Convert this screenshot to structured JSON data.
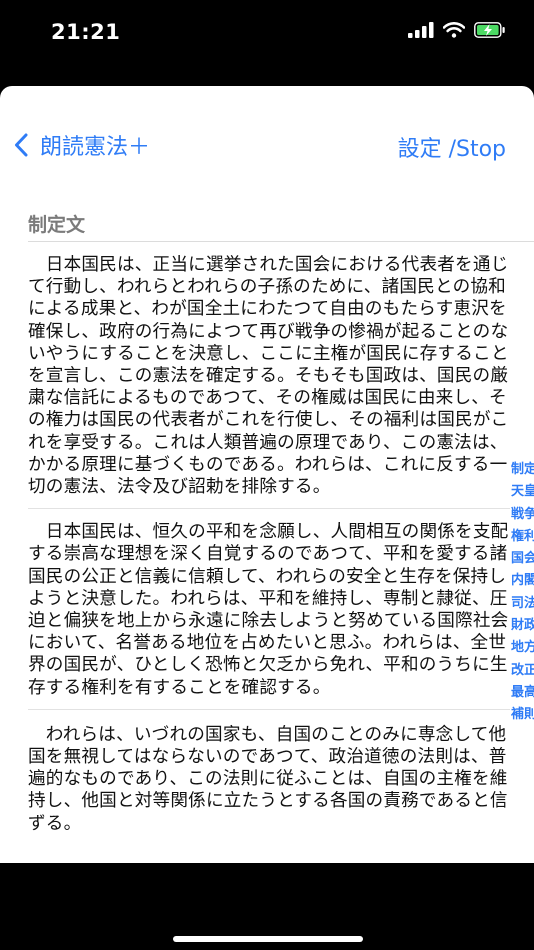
{
  "status_bar": {
    "time": "21:21",
    "battery_color": "#4cd964"
  },
  "nav": {
    "back_label": "朗読憲法＋",
    "right_label": "設定 /Stop",
    "accent_color": "#2f7cf6"
  },
  "section": {
    "title": "制定文"
  },
  "paragraphs": [
    "　日本国民は、正当に選挙された国会における代表者を通じて行動し、われらとわれらの子孫のために、諸国民との協和による成果と、わが国全土にわたつて自由のもたらす恵沢を確保し、政府の行為によつて再び戦争の惨禍が起ることのないやうにすることを決意し、ここに主権が国民に存することを宣言し、この憲法を確定する。そもそも国政は、国民の厳粛な信託によるものであつて、その権威は国民に由来し、その権力は国民の代表者がこれを行使し、その福利は国民がこれを享受する。これは人類普遍の原理であり、この憲法は、かかる原理に基づくものである。われらは、これに反する一切の憲法、法令及び詔勅を排除する。",
    "　日本国民は、恒久の平和を念願し、人間相互の関係を支配する崇高な理想を深く自覚するのであつて、平和を愛する諸国民の公正と信義に信頼して、われらの安全と生存を保持しようと決意した。われらは、平和を維持し、専制と隷従、圧迫と偏狭を地上から永遠に除去しようと努めている国際社会において、名誉ある地位を占めたいと思ふ。われらは、全世界の国民が、ひとしく恐怖と欠乏から免れ、平和のうちに生存する権利を有することを確認する。",
    "　われらは、いづれの国家も、自国のことのみに専念して他国を無視してはならないのであつて、政治道徳の法則は、普遍的なものであり、この法則に従ふことは、自国の主権を維持し、他国と対等関係に立たうとする各国の責務であると信ずる。"
  ],
  "index": [
    "制定文",
    "天皇",
    "戦争の放棄",
    "権利",
    "国会",
    "内閣",
    "司法",
    "財政",
    "地方自治",
    "改正",
    "最高法規",
    "補則"
  ]
}
